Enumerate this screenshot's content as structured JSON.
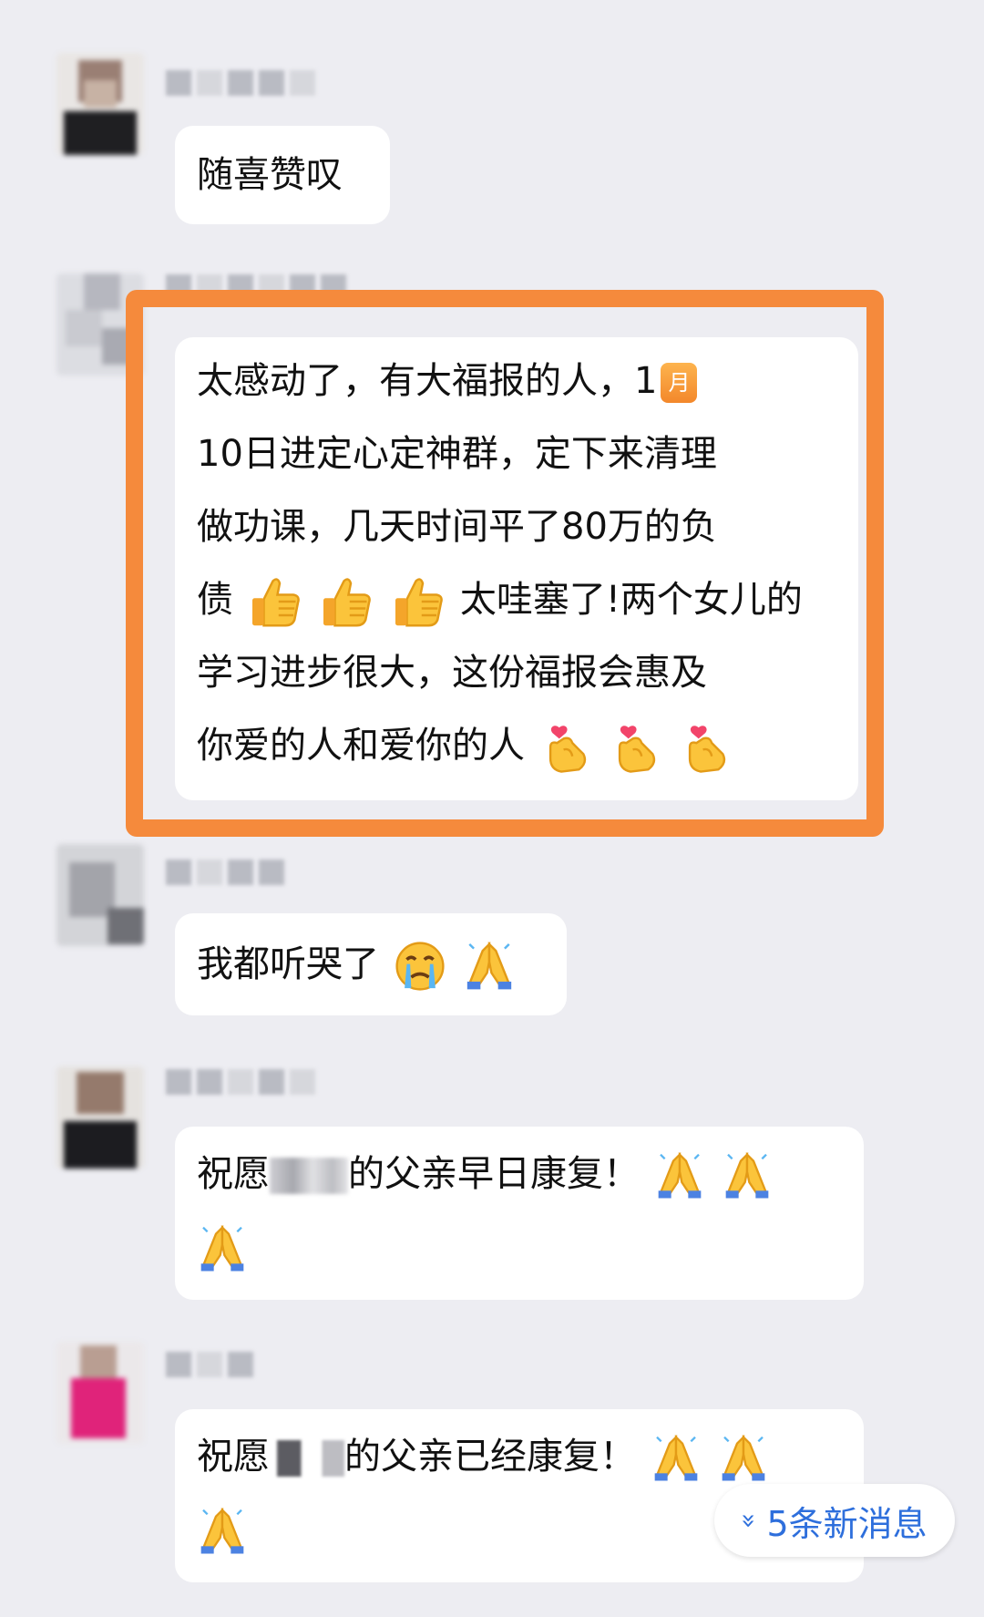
{
  "messages": [
    {
      "text_lines": [
        "随喜赞叹"
      ]
    },
    {
      "text_lines": [
        "太感动了，有大福报的人，1",
        "10日进定心定神群，定下来清理",
        "做功课，几天时间平了80万的负",
        "债",
        "太哇塞了!两个女儿的",
        "学习进步很大，这份福报会惠及",
        "你爱的人和爱你的人"
      ],
      "calendar_icon_text": "月"
    },
    {
      "text_lines": [
        "我都听哭了"
      ]
    },
    {
      "text_lines": [
        "祝愿",
        "的父亲早日康复！"
      ]
    },
    {
      "text_lines": [
        "祝愿",
        "的父亲已经康复！"
      ]
    }
  ],
  "new_messages_pill": {
    "label": "5条新消息",
    "chevron": "»"
  },
  "colors": {
    "background": "#ededf2",
    "bubble": "#ffffff",
    "highlight": "#f58a3c",
    "link": "#2e6fdc"
  },
  "icons": [
    "thumbs-up-icon",
    "finger-heart-icon",
    "crying-face-icon",
    "folded-hands-icon",
    "calendar-icon",
    "chevron-down-icon"
  ]
}
